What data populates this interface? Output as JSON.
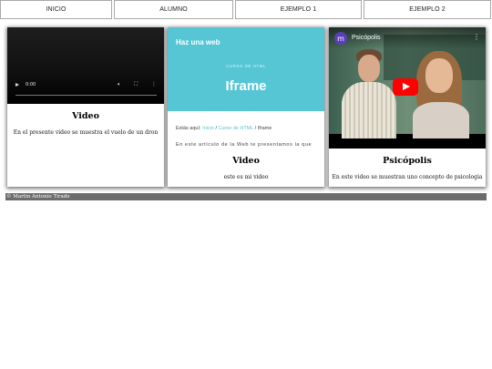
{
  "nav": {
    "items": [
      {
        "label": "INICIO"
      },
      {
        "label": "ALUMNO"
      },
      {
        "label": "EJEMPLO 1"
      },
      {
        "label": "EJEMPLO 2"
      }
    ]
  },
  "cards": [
    {
      "media": {
        "time": "0:00"
      },
      "title": "Video",
      "text": "En el presente video se muestra el vuelo de un dron"
    },
    {
      "media": {
        "site": "Haz una web",
        "kicker": "CURSO DE HTML",
        "page_title": "Iframe",
        "crumb_prefix": "Estás aquí:",
        "crumb_home": "Inicio",
        "crumb_sep1": "/",
        "crumb_course": "Curso de HTML",
        "crumb_sep2": "/",
        "crumb_current": "Iframe",
        "body_text": "En este artículo de la Web te presentamos la que"
      },
      "title": "Video",
      "text": "este es mi video"
    },
    {
      "media": {
        "channel_initial": "m",
        "channel": "Psicópolis"
      },
      "title": "Psicópolis",
      "text": "En este video se muestran uno concepto de psicologia"
    }
  ],
  "footer": {
    "text": "© Martin Antonio Tirado"
  },
  "icons": {
    "play": "play-icon",
    "volume": "volume-icon",
    "fullscreen": "fullscreen-icon",
    "more": "more-vertical-icon",
    "youtube_play": "youtube-play-icon"
  },
  "colors": {
    "footer_bg": "#6c6c6c",
    "iframe_hero": "#56c6d5",
    "youtube_red": "#ff0000"
  }
}
